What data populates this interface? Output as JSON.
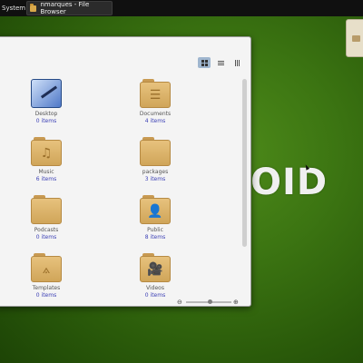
{
  "panel": {
    "system_label": "System",
    "taskbar_label": "nmarques - File Browser"
  },
  "desktop": {
    "logo": "OID"
  },
  "file_browser": {
    "items": [
      {
        "name": "Desktop",
        "count": "0 items",
        "icon": "desktop-icon"
      },
      {
        "name": "Documents",
        "count": "4 items",
        "icon": "documents-folder-icon"
      },
      {
        "name": "Music",
        "count": "6 items",
        "icon": "music-folder-icon"
      },
      {
        "name": "packages",
        "count": "3 items",
        "icon": "folder-icon"
      },
      {
        "name": "Podcasts",
        "count": "0 items",
        "icon": "folder-icon"
      },
      {
        "name": "Public",
        "count": "8 items",
        "icon": "public-folder-icon"
      },
      {
        "name": "Templates",
        "count": "0 items",
        "icon": "templates-folder-icon"
      },
      {
        "name": "Videos",
        "count": "0 items",
        "icon": "videos-folder-icon"
      }
    ]
  }
}
